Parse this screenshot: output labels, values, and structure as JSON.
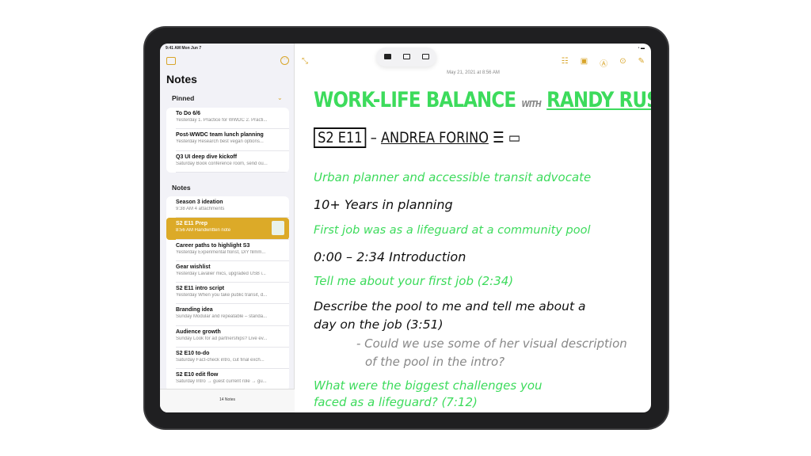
{
  "status": {
    "time": "9:41 AM  Mon Jun 7"
  },
  "sidebar": {
    "title": "Notes",
    "pinned_label": "Pinned",
    "notes_label": "Notes",
    "footer": "14 Notes",
    "pinned": [
      {
        "title": "To Do 6/6",
        "sub": "Yesterday  1. Practice for WWDC 2. Practi..."
      },
      {
        "title": "Post-WWDC team lunch planning",
        "sub": "Yesterday  Research best vegan options..."
      },
      {
        "title": "Q3 UI deep dive kickoff",
        "sub": "Saturday  Book conference room, send ou..."
      }
    ],
    "notes": [
      {
        "title": "Season 3 ideation",
        "sub": "9:38 AM  4 attachments"
      },
      {
        "title": "S2 E11 Prep",
        "sub": "8:56 AM  Handwritten note",
        "selected": true
      },
      {
        "title": "Career paths to highlight S3",
        "sub": "Yesterday  Experimental florist, DIY filmm..."
      },
      {
        "title": "Gear wishlist",
        "sub": "Yesterday  Lavalier mics, upgraded USB i..."
      },
      {
        "title": "S2 E11 intro script",
        "sub": "Yesterday  When you take public transit, d..."
      },
      {
        "title": "Branding idea",
        "sub": "Sunday  Modular and repeatable – standa..."
      },
      {
        "title": "Audience growth",
        "sub": "Sunday  Look for ad partnerships? Live ev..."
      },
      {
        "title": "S2 E10 to-do",
        "sub": "Saturday  Fact-check intro, cut final exch..."
      },
      {
        "title": "S2 E10 edit flow",
        "sub": "Saturday  Intro → guest current role → gu..."
      }
    ]
  },
  "note": {
    "date": "May 21, 2021 at 8:56 AM",
    "lines": {
      "title": "WORK-LIFE BALANCE",
      "with": "WITH",
      "host": "RANDY RUSSO",
      "episode": "S2 E11",
      "dash": "–",
      "guest": "ANDREA FORINO",
      "l1": "Urban planner and accessible transit advocate",
      "l2": "10+ Years in planning",
      "l3": "First job was as a lifeguard at a community pool",
      "l4": "0:00 – 2:34 Introduction",
      "l5": "Tell me about your first job (2:34)",
      "l6": "Describe the pool to me and tell me about a",
      "l7": "day on the job (3:51)",
      "l8": "- Could we use some of her visual description",
      "l9": "of the pool in the intro?",
      "l10": "What were the biggest challenges you",
      "l11": "faced as a lifeguard? (7:12)"
    }
  },
  "colors": {
    "accent": "#dcaa28",
    "ink_green": "#3ddb5c"
  }
}
